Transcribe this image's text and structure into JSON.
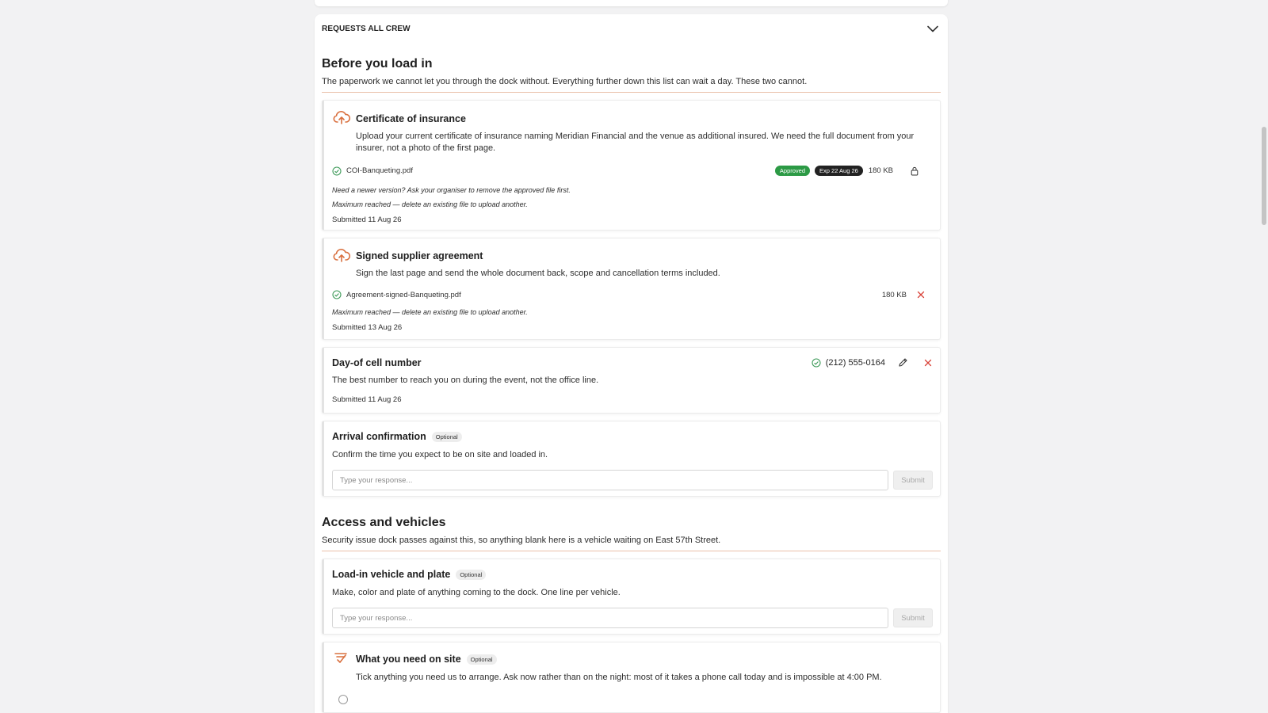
{
  "crew_header": {
    "label": "REQUESTS ALL CREW"
  },
  "sections": {
    "before": {
      "title": "Before you load in",
      "desc": "The paperwork we cannot let you through the dock without. Everything further down this list can wait a day. These two cannot."
    },
    "access": {
      "title": "Access and vehicles",
      "desc": "Security issue dock passes against this, so anything blank here is a vehicle waiting on East 57th Street."
    }
  },
  "cards": {
    "insurance": {
      "title": "Certificate of insurance",
      "desc": "Upload your current certificate of insurance naming Meridian Financial and the venue as additional insured. We need the full document from your insurer, not a photo of the first page.",
      "file_name": "COI-Banqueting.pdf",
      "status": "Approved",
      "expiry": "Exp 22 Aug 26",
      "size": "180 KB",
      "note1": "Need a newer version? Ask your organiser to remove the approved file first.",
      "note2": "Maximum reached — delete an existing file to upload another.",
      "submitted": "Submitted 11 Aug 26"
    },
    "agreement": {
      "title": "Signed supplier agreement",
      "desc": "Sign the last page and send the whole document back, scope and cancellation terms included.",
      "file_name": "Agreement-signed-Banqueting.pdf",
      "size": "180 KB",
      "note": "Maximum reached — delete an existing file to upload another.",
      "submitted": "Submitted 13 Aug 26"
    },
    "cell": {
      "title": "Day-of cell number",
      "value": "(212) 555-0164",
      "desc": "The best number to reach you on during the event, not the office line.",
      "submitted": "Submitted 11 Aug 26"
    },
    "arrival": {
      "title": "Arrival confirmation",
      "badge": "Optional",
      "desc": "Confirm the time you expect to be on site and loaded in.",
      "placeholder": "Type your response...",
      "submit": "Submit"
    },
    "vehicle": {
      "title": "Load-in vehicle and plate",
      "badge": "Optional",
      "desc": "Make, color and plate of anything coming to the dock. One line per vehicle.",
      "placeholder": "Type your response...",
      "submit": "Submit"
    },
    "needs": {
      "title": "What you need on site",
      "badge": "Optional",
      "desc": "Tick anything you need us to arrange. Ask now rather than on the night: most of it takes a phone call today and is impossible at 4:00 PM."
    }
  },
  "colors": {
    "accent": "#d9703f",
    "approved": "#2c9a45",
    "success": "#3f9b5a",
    "danger": "#d9443a"
  },
  "icons": [
    "upload-cloud-icon",
    "check-circle-icon",
    "lock-icon",
    "close-icon",
    "pencil-icon",
    "chevron-down-icon",
    "checklist-icon"
  ]
}
